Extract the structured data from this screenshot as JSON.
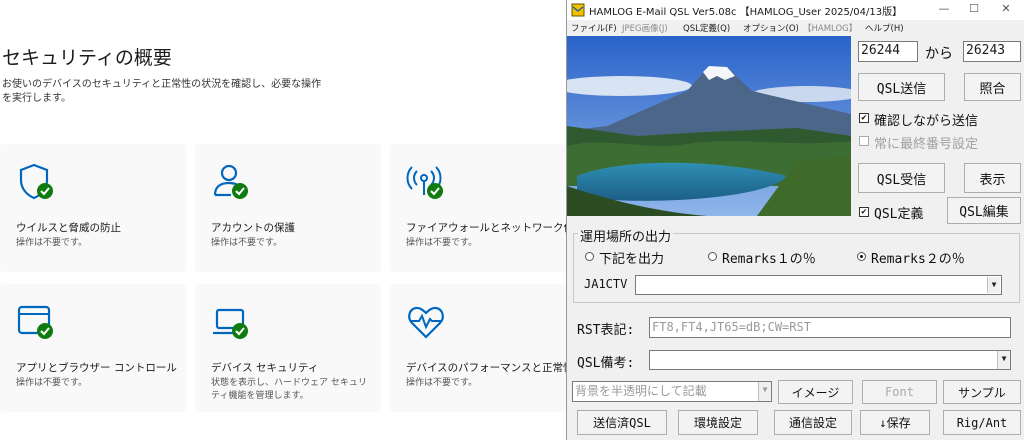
{
  "security": {
    "title": "セキュリティの概要",
    "description": "お使いのデバイスのセキュリティと正常性の状況を確認し、必要な操作を実行します。",
    "cards": [
      {
        "title": "ウイルスと脅威の防止",
        "status": "操作は不要です。",
        "icon": "shield-check-icon"
      },
      {
        "title": "アカウントの保護",
        "status": "操作は不要です。",
        "icon": "person-check-icon"
      },
      {
        "title": "ファイアウォールとネットワーク保護",
        "status": "操作は不要です。",
        "icon": "antenna-check-icon"
      },
      {
        "title": "アプリとブラウザー コントロール",
        "status": "操作は不要です。",
        "icon": "browser-check-icon"
      },
      {
        "title": "デバイス セキュリティ",
        "status": "状態を表示し、ハードウェア セキュリティ機能を管理します。",
        "icon": "laptop-check-icon"
      },
      {
        "title": "デバイスのパフォーマンスと正常性",
        "status": "操作は不要です。",
        "icon": "heart-pulse-icon"
      }
    ],
    "accent": "#0067c0",
    "ok_color": "#107c10"
  },
  "hamlog": {
    "window_title": "HAMLOG E-Mail QSL Ver5.08c 【HAMLOG_User 2025/04/13版】",
    "window_controls": [
      "—",
      "☐",
      "✕"
    ],
    "menu": [
      {
        "label": "ファイル(F)",
        "enabled": true
      },
      {
        "label": "JPEG画像(J)",
        "enabled": false
      },
      {
        "label": "QSL定義(Q)",
        "enabled": true
      },
      {
        "label": "オプション(O)",
        "enabled": true
      },
      {
        "label": "【HAMLOG】",
        "enabled": false
      },
      {
        "label": "ヘルプ(H)",
        "enabled": true
      }
    ],
    "range_from": "26244",
    "range_sep": "から",
    "range_to": "26243",
    "btn_send": "QSL送信",
    "btn_check": "照合",
    "chk_confirm_label": "確認しながら送信",
    "chk_confirm_mark": "✔",
    "chk_last_label": "常に最終番号設定",
    "btn_receive": "QSL受信",
    "btn_display": "表示",
    "chk_def_label": "QSL定義",
    "chk_def_mark": "✔",
    "btn_edit": "QSL編集",
    "group_title": "運用場所の出力",
    "radios": [
      {
        "label": "下記を出力",
        "selected": false
      },
      {
        "label": "Remarks１の％",
        "selected": false
      },
      {
        "label": "Remarks２の％",
        "selected": true
      }
    ],
    "location_value": "JA1CTV",
    "rst_label": "RST表記:",
    "rst_value": "FT8,FT4,JT65=dB;CW=RST",
    "remarks_label": "QSL備考:",
    "remarks_value": "",
    "bg_select": "背景を半透明にして記載",
    "btn_image": "イメージ",
    "btn_font": "Font",
    "btn_sample": "サンプル",
    "btn_sent": "送信済QSL",
    "btn_env": "環境設定",
    "btn_comm": "通信設定",
    "btn_save": "↓保存",
    "btn_rig": "Rig/Ant"
  }
}
